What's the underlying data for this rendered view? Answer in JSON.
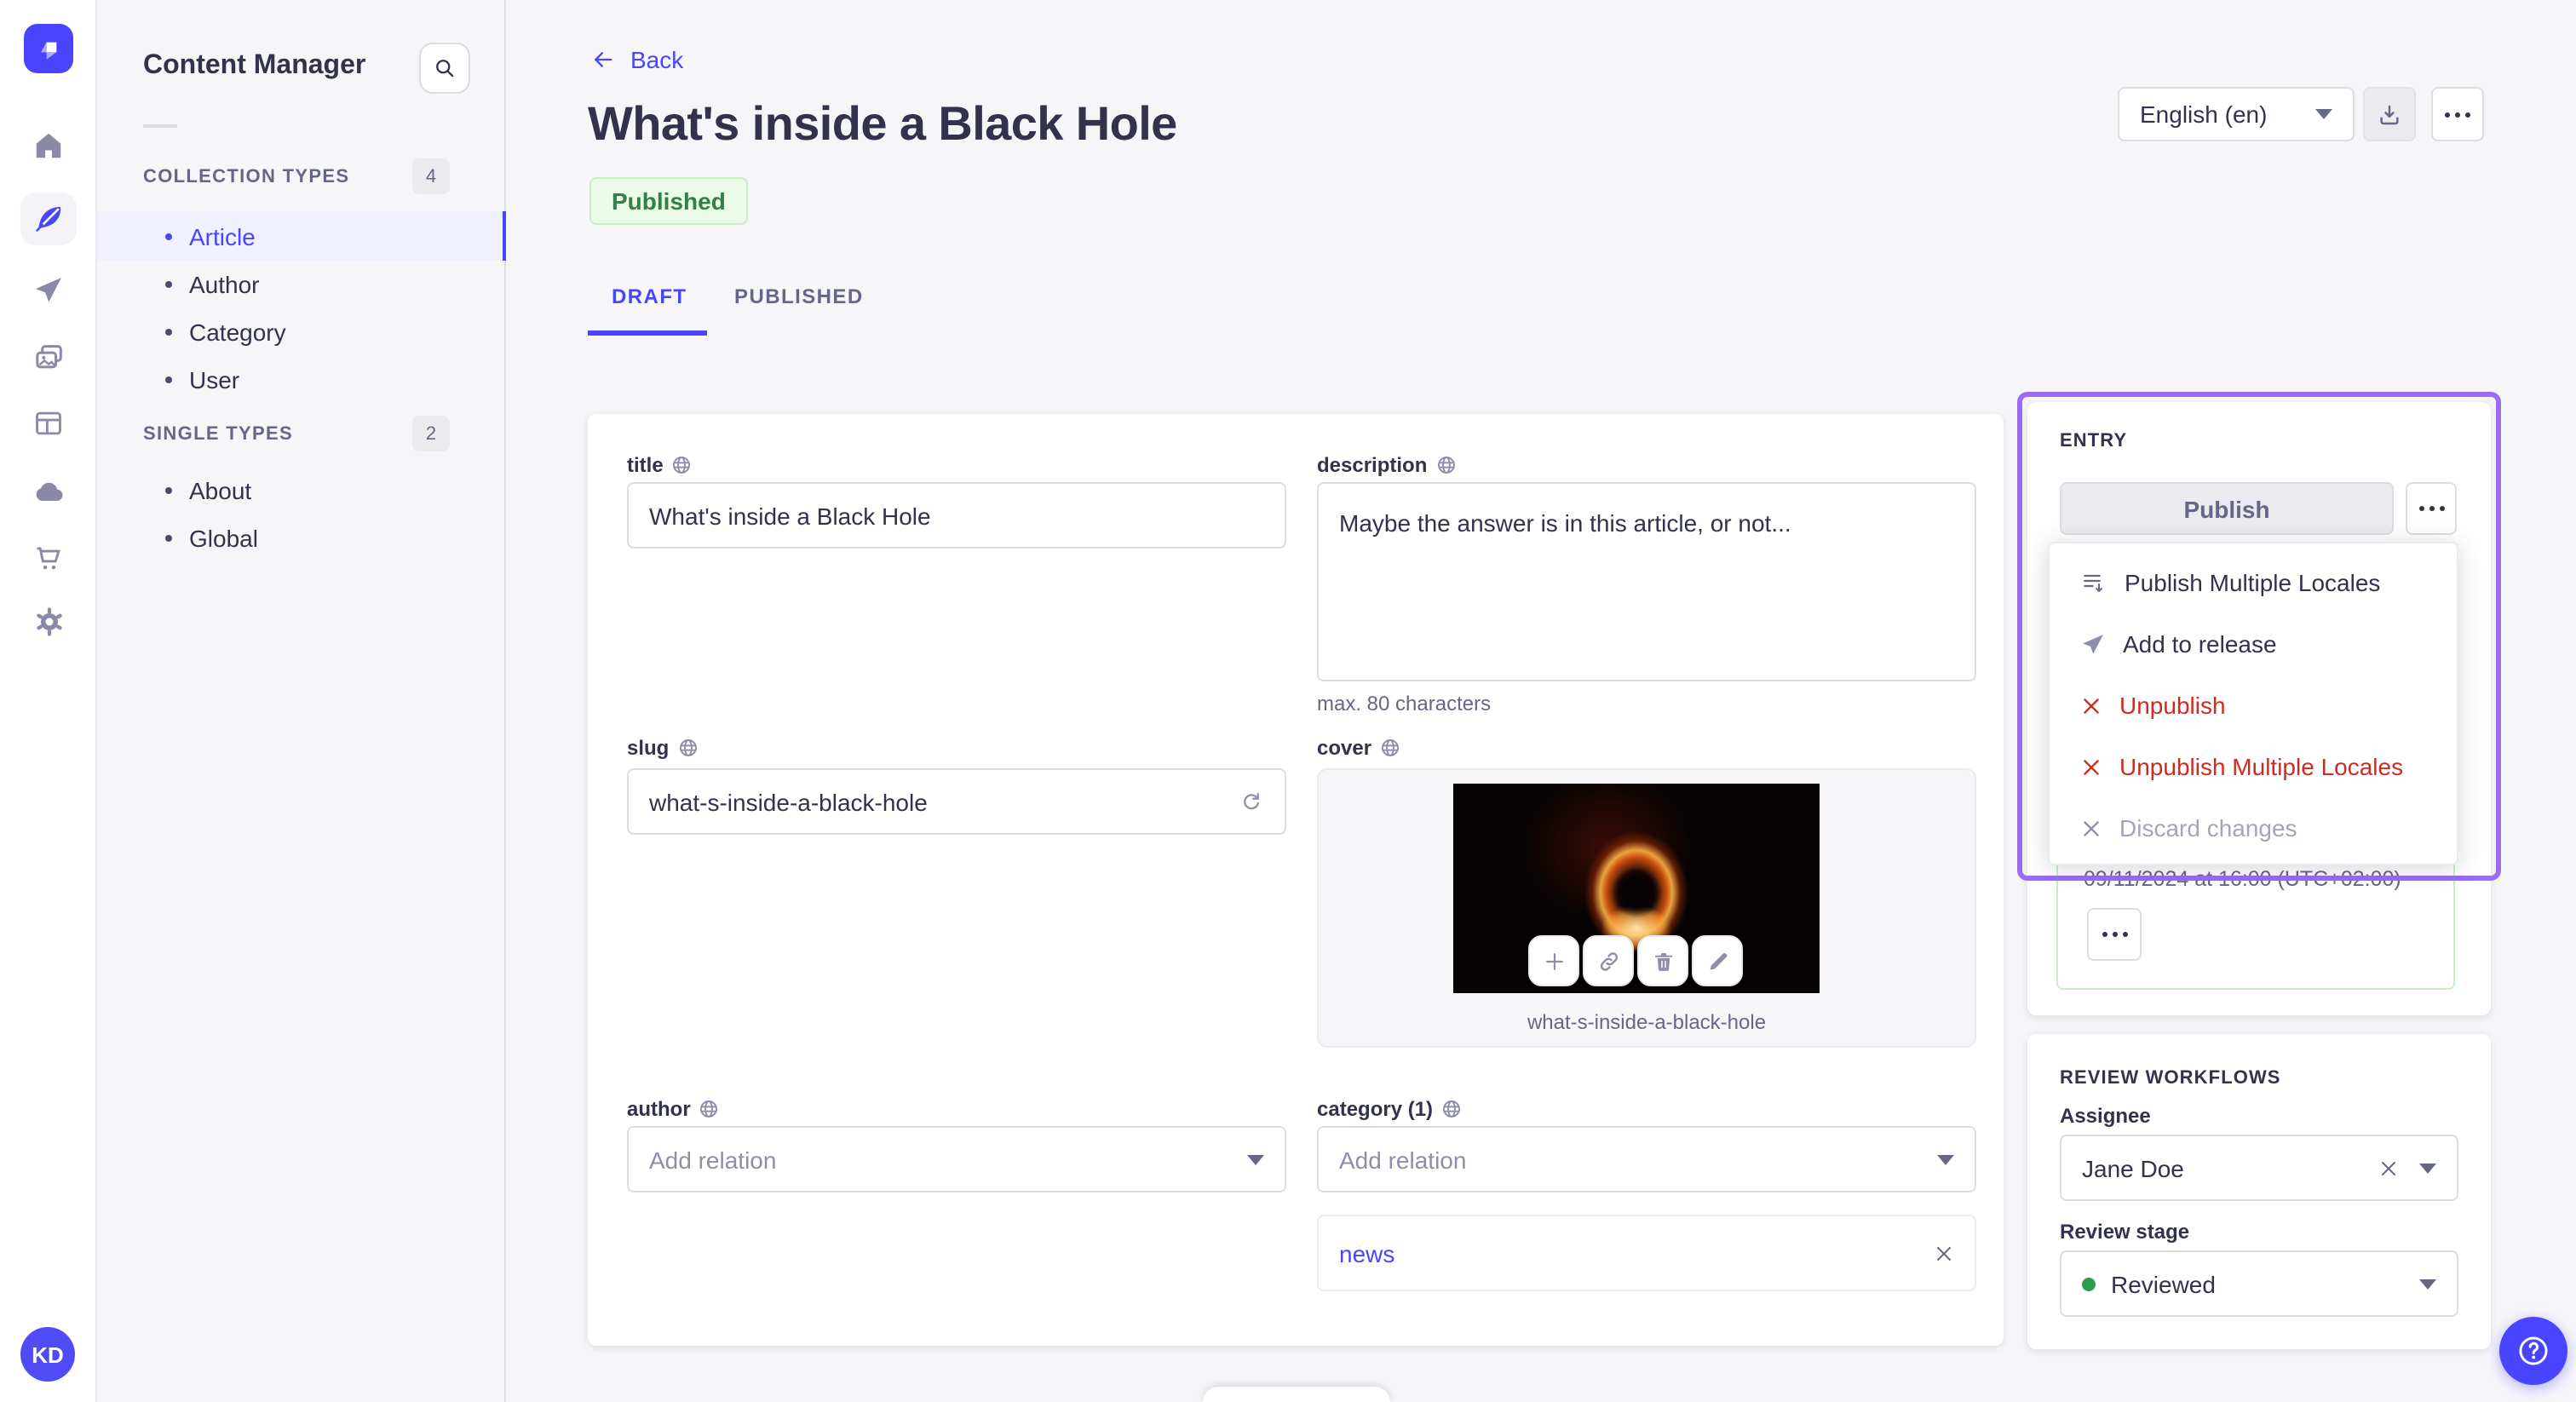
{
  "sidebar": {
    "user_initials": "KD"
  },
  "nav": {
    "title": "Content Manager",
    "sections": [
      {
        "label": "COLLECTION TYPES",
        "count": "4",
        "items": [
          {
            "label": "Article"
          },
          {
            "label": "Author"
          },
          {
            "label": "Category"
          },
          {
            "label": "User"
          }
        ]
      },
      {
        "label": "SINGLE TYPES",
        "count": "2",
        "items": [
          {
            "label": "About"
          },
          {
            "label": "Global"
          }
        ]
      }
    ]
  },
  "header": {
    "back_label": "Back",
    "title": "What's inside a Black Hole",
    "status_badge": "Published",
    "locale": "English (en)",
    "tabs": [
      {
        "label": "DRAFT"
      },
      {
        "label": "PUBLISHED"
      }
    ]
  },
  "form": {
    "title": {
      "label": "title",
      "value": "What's inside a Black Hole"
    },
    "description": {
      "label": "description",
      "value": "Maybe the answer is in this article, or not...",
      "hint": "max. 80 characters"
    },
    "slug": {
      "label": "slug",
      "value": "what-s-inside-a-black-hole"
    },
    "cover": {
      "label": "cover",
      "caption": "what-s-inside-a-black-hole"
    },
    "author": {
      "label": "author",
      "placeholder": "Add relation"
    },
    "category": {
      "label": "category (1)",
      "placeholder": "Add relation",
      "selected": "news"
    }
  },
  "entry_panel": {
    "heading": "ENTRY",
    "publish_label": "Publish",
    "menu": [
      {
        "label": "Publish Multiple Locales"
      },
      {
        "label": "Add to release"
      },
      {
        "label": "Unpublish"
      },
      {
        "label": "Unpublish Multiple Locales"
      },
      {
        "label": "Discard changes"
      }
    ],
    "scheduled_date": "09/11/2024 at 16:00 (UTC+02:00)"
  },
  "review_panel": {
    "heading": "REVIEW WORKFLOWS",
    "assignee_label": "Assignee",
    "assignee_value": "Jane Doe",
    "stage_label": "Review stage",
    "stage_value": "Reviewed"
  },
  "colors": {
    "primary": "#4945ff",
    "highlight_purple": "#9b6bf3",
    "danger": "#d02b20",
    "success_text": "#328048",
    "success_bg": "#eafbe7",
    "success_border": "#c6f0c2"
  }
}
